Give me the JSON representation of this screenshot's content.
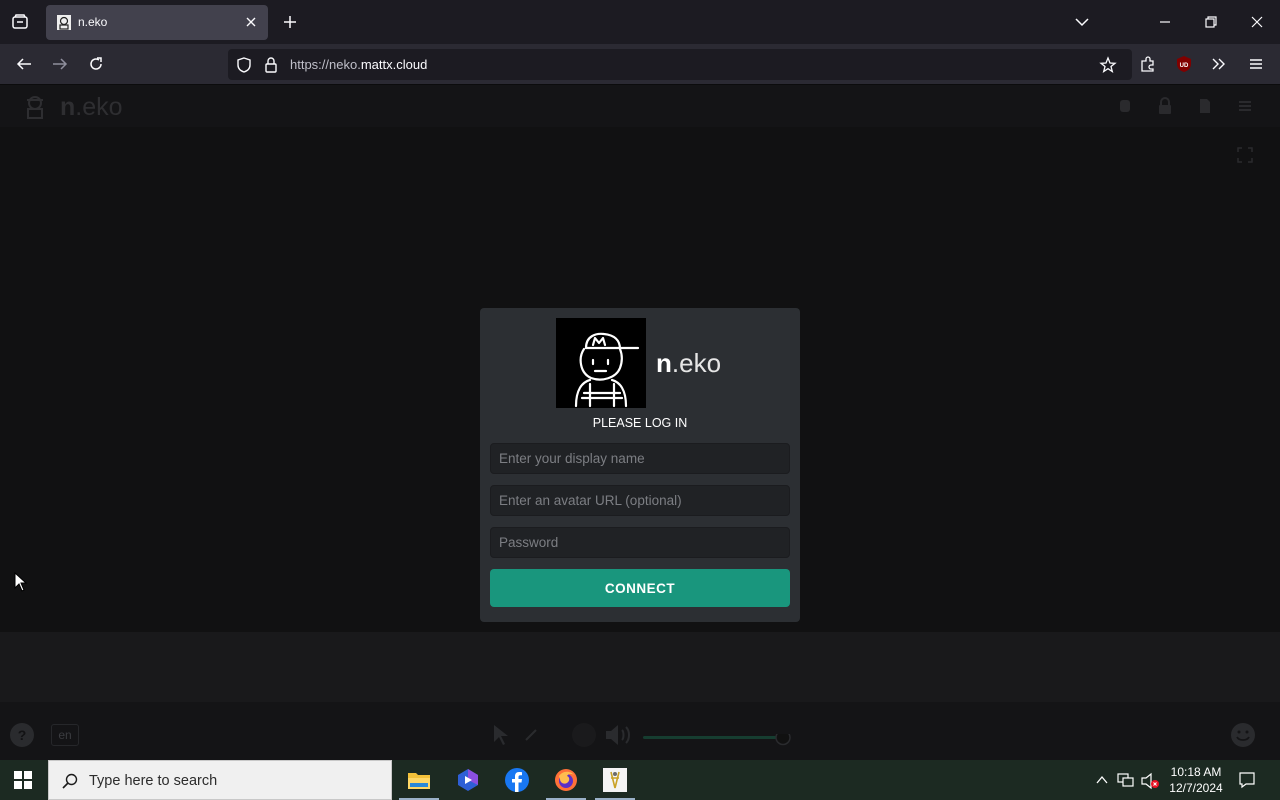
{
  "browser": {
    "tab_title": "n.eko",
    "url_prefix": "https://neko.",
    "url_domain": "mattx.cloud"
  },
  "neko": {
    "header_brand_bold": "n",
    "header_brand_rest": ".eko",
    "login": {
      "logo_bold": "n",
      "logo_rest": ".eko",
      "heading": "PLEASE LOG IN",
      "display_name_placeholder": "Enter your display name",
      "avatar_placeholder": "Enter an avatar URL (optional)",
      "password_placeholder": "Password",
      "connect_label": "CONNECT"
    },
    "footer": {
      "language": "en"
    }
  },
  "taskbar": {
    "search_placeholder": "Type here to search",
    "time": "10:18 AM",
    "date": "12/7/2024"
  },
  "colors": {
    "accent": "#19967d",
    "panel": "#2c2f33"
  }
}
